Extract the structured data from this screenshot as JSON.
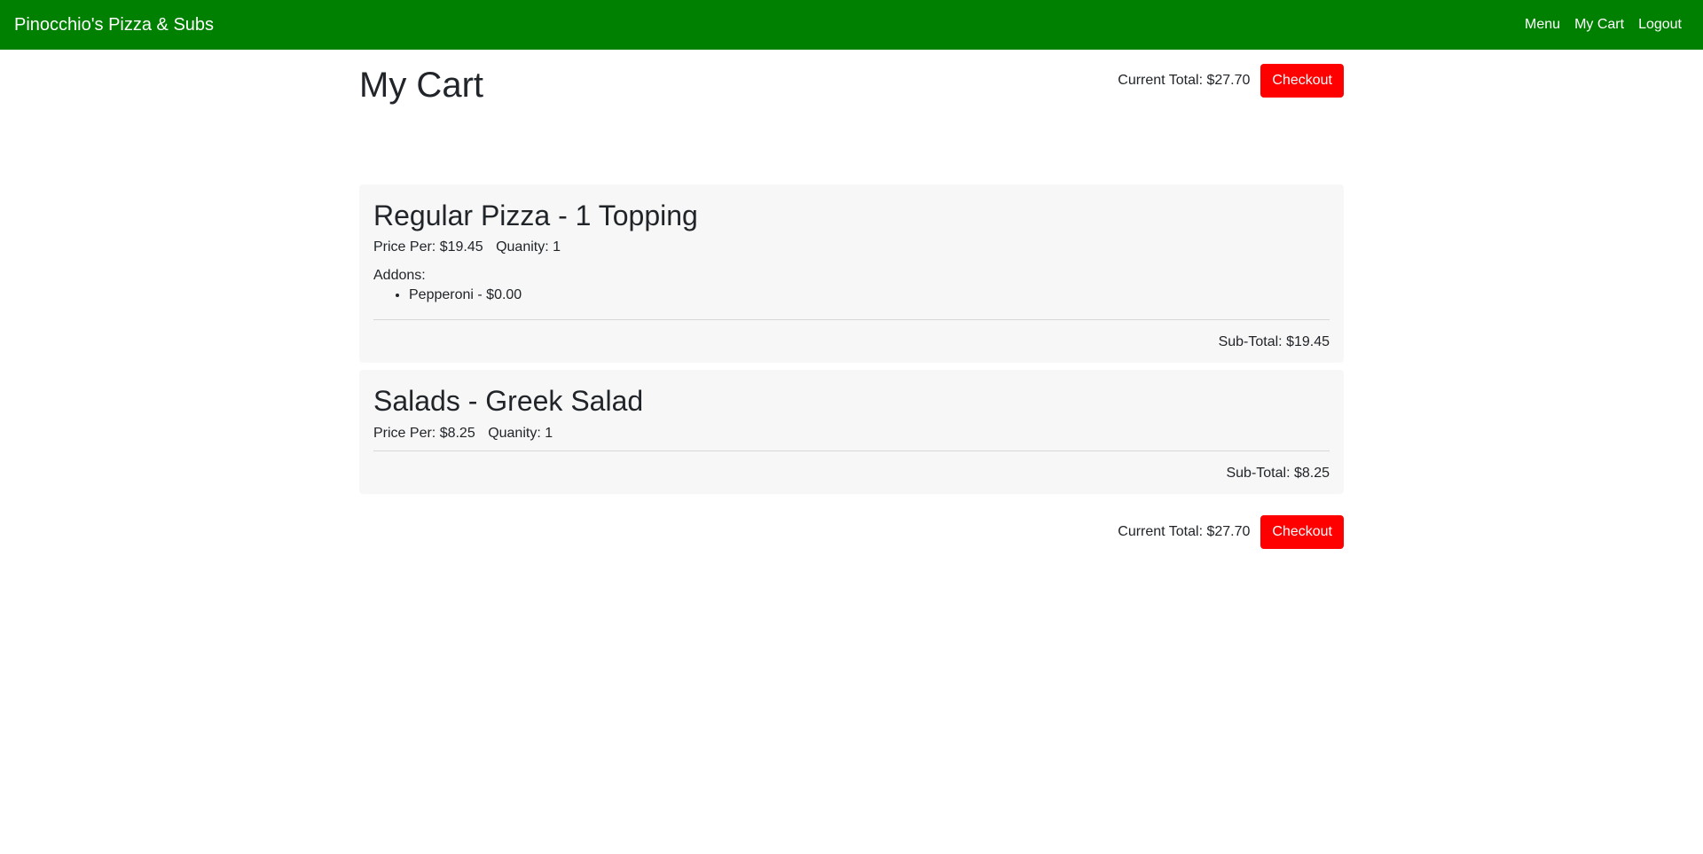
{
  "navbar": {
    "brand": "Pinocchio's Pizza & Subs",
    "links": [
      "Menu",
      "My Cart",
      "Logout"
    ]
  },
  "page": {
    "title": "My Cart",
    "current_total": "Current Total: $27.70",
    "checkout_label": "Checkout"
  },
  "items": [
    {
      "title": "Regular Pizza - 1 Topping",
      "price_per": "Price Per: $19.45",
      "quantity": "Quanity: 1",
      "addons_label": "Addons:",
      "addons": [
        "Pepperoni - $0.00"
      ],
      "subtotal": "Sub-Total: $19.45"
    },
    {
      "title": "Salads - Greek Salad",
      "price_per": "Price Per: $8.25",
      "quantity": "Quanity: 1",
      "subtotal": "Sub-Total: $8.25"
    }
  ],
  "colors": {
    "navbar": "#008000",
    "checkout": "#ff0000",
    "card": "#f7f7f7"
  }
}
